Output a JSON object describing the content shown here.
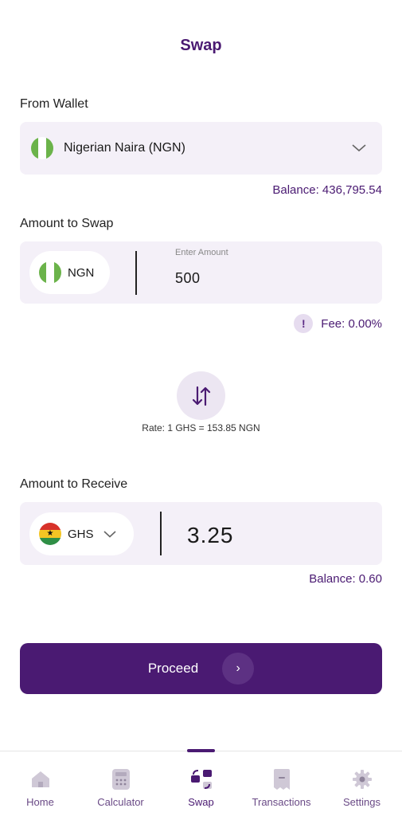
{
  "header": {
    "title": "Swap"
  },
  "from_wallet": {
    "label": "From Wallet",
    "selected": "Nigerian Naira (NGN)",
    "flag_icon": "nigeria-flag-icon",
    "balance": "Balance: 436,795.54"
  },
  "amount_to_swap": {
    "label": "Amount to Swap",
    "currency": "NGN",
    "input_label": "Enter Amount",
    "value": "500",
    "fee": "Fee: 0.00%"
  },
  "swap": {
    "icon": "swap-arrows-icon",
    "rate": "Rate: 1 GHS = 153.85 NGN"
  },
  "amount_to_receive": {
    "label": "Amount to Receive",
    "currency": "GHS",
    "flag_icon": "ghana-flag-icon",
    "value": "3.25",
    "balance": "Balance: 0.60"
  },
  "proceed": {
    "label": "Proceed",
    "arrow": "›"
  },
  "bottom_nav": {
    "items": [
      {
        "label": "Home",
        "icon": "home-icon"
      },
      {
        "label": "Calculator",
        "icon": "calculator-icon"
      },
      {
        "label": "Swap",
        "icon": "swap-icon",
        "active": true
      },
      {
        "label": "Transactions",
        "icon": "receipt-icon"
      },
      {
        "label": "Settings",
        "icon": "gear-icon"
      }
    ]
  },
  "colors": {
    "brand": "#4a1a72",
    "field_bg": "#f4f0f8"
  }
}
